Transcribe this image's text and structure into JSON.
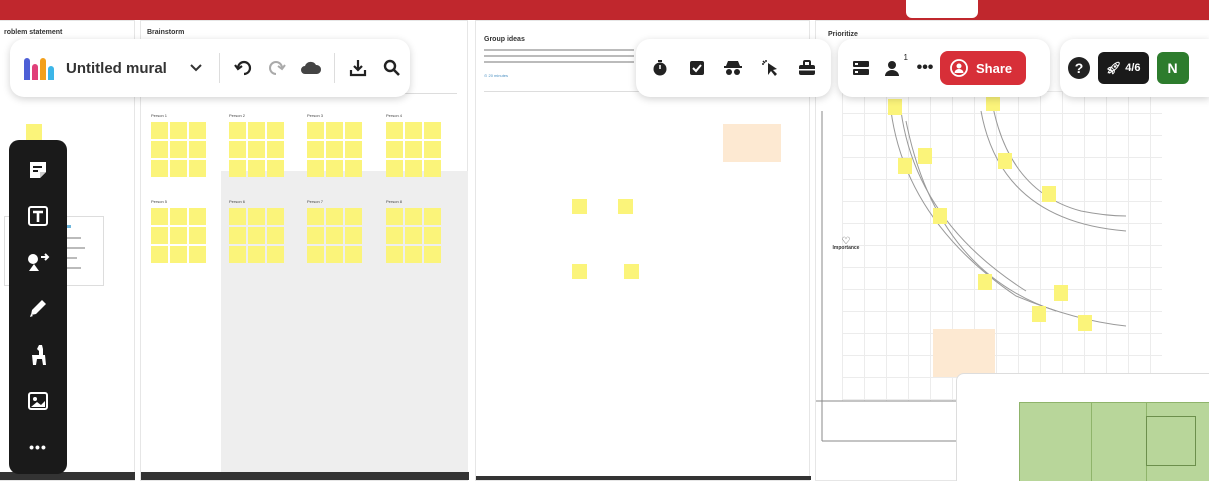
{
  "app": {
    "mural_title": "Untitled mural",
    "collaborator_count": "1",
    "share_label": "Share",
    "progress_label": "4/6",
    "user_initial": "N",
    "help_label": "?"
  },
  "areas": {
    "problem_statement": "roblem statement",
    "brainstorm": "Brainstorm",
    "group_ideas": "Group ideas",
    "prioritize": "Prioritize",
    "group_ideas_time": "⊙ 20 minutes",
    "importance": "Importance"
  },
  "brainstorm_groups": [
    "Person 1",
    "Person 2",
    "Person 3",
    "Person 4",
    "Person 5",
    "Person 6",
    "Person 7",
    "Person 8"
  ],
  "icons": {
    "timer": "timer-icon",
    "checklist": "checklist-icon",
    "private_mode": "private-mode-icon",
    "summon": "summon-icon",
    "outline": "outline-icon",
    "undo": "undo-icon",
    "redo": "redo-icon",
    "cloud": "cloud-icon",
    "export": "export-icon",
    "search": "search-icon"
  },
  "colors": {
    "accent_red": "#c0272d",
    "share_red": "#d72f38",
    "sticky_yellow": "#fbf47a",
    "toolbar_dark": "#1a1a1a",
    "avatar_green": "#2d7c2d"
  }
}
